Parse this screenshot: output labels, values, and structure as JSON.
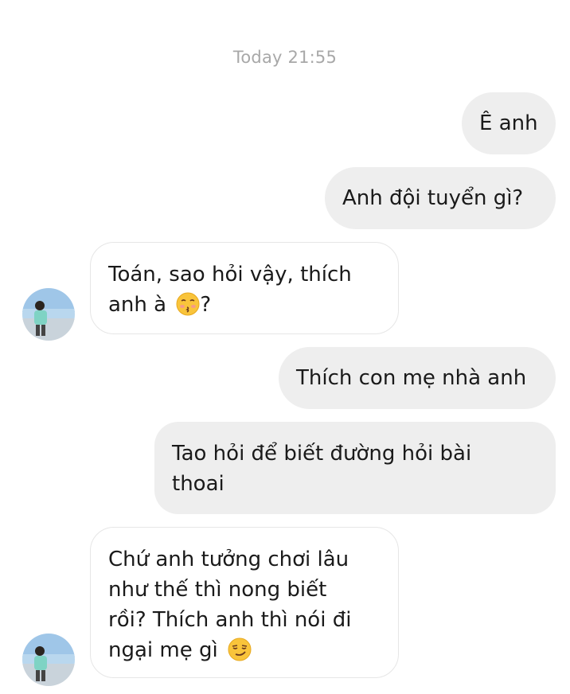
{
  "thread": {
    "timestamp": "Today 21:55"
  },
  "messages": [
    {
      "sender": "me",
      "text": "Ê anh"
    },
    {
      "sender": "me",
      "text": "Anh đội tuyển gì?"
    },
    {
      "sender": "other",
      "line1": "Toán, sao hỏi vậy, thích",
      "line2_pre": "anh à ",
      "line2_post": "?",
      "emoji": "kissing-face-emoji"
    },
    {
      "sender": "me",
      "text": "Thích con mẹ nhà anh"
    },
    {
      "sender": "me",
      "line1": "Tao hỏi để biết đường hỏi bài",
      "line2": "thoai"
    },
    {
      "sender": "other",
      "line1": "Chứ anh tưởng chơi lâu",
      "line2": "như thế thì nong biết",
      "line3": "rồi? Thích anh thì nói đi",
      "line4_pre": "ngại mẹ gì ",
      "emoji": "smirking-face-emoji"
    }
  ],
  "colors": {
    "sent_bubble": "#eeeeee",
    "received_border": "#e6e6e6",
    "timestamp": "#a8a8a8"
  }
}
